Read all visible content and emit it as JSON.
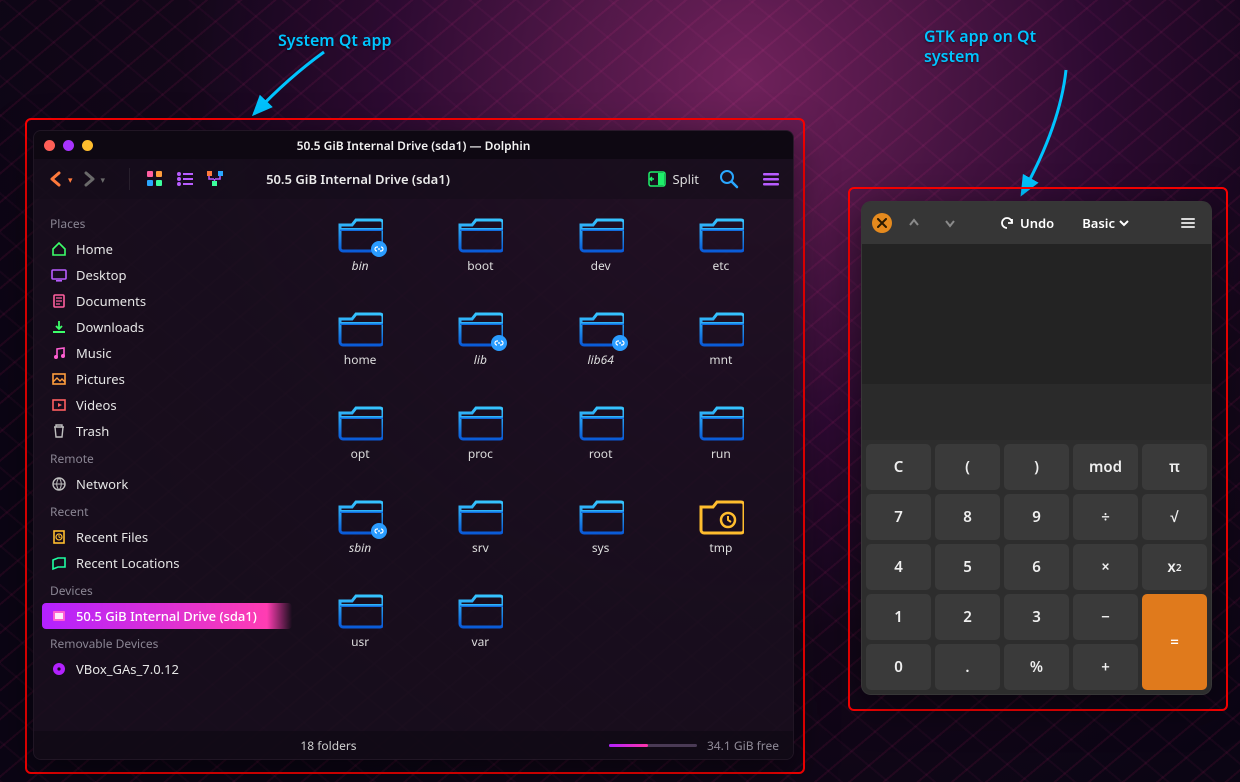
{
  "annotations": {
    "left": "System Qt app",
    "right": "GTK app on Qt\nsystem"
  },
  "dolphin": {
    "title": "50.5 GiB Internal Drive (sda1) — Dolphin",
    "breadcrumb": "50.5 GiB Internal Drive (sda1)",
    "split_label": "Split",
    "sidebar": {
      "sections": [
        {
          "header": "Places",
          "items": [
            {
              "label": "Home",
              "icon": "home"
            },
            {
              "label": "Desktop",
              "icon": "desktop"
            },
            {
              "label": "Documents",
              "icon": "documents"
            },
            {
              "label": "Downloads",
              "icon": "downloads"
            },
            {
              "label": "Music",
              "icon": "music"
            },
            {
              "label": "Pictures",
              "icon": "pictures"
            },
            {
              "label": "Videos",
              "icon": "videos"
            },
            {
              "label": "Trash",
              "icon": "trash"
            }
          ]
        },
        {
          "header": "Remote",
          "items": [
            {
              "label": "Network",
              "icon": "network"
            }
          ]
        },
        {
          "header": "Recent",
          "items": [
            {
              "label": "Recent Files",
              "icon": "recent-files"
            },
            {
              "label": "Recent Locations",
              "icon": "recent-locations"
            }
          ]
        },
        {
          "header": "Devices",
          "items": [
            {
              "label": "50.5 GiB Internal Drive (sda1)",
              "icon": "drive",
              "selected": true
            }
          ]
        },
        {
          "header": "Removable Devices",
          "items": [
            {
              "label": "VBox_GAs_7.0.12",
              "icon": "disc"
            }
          ]
        }
      ]
    },
    "folders": [
      {
        "name": "bin",
        "link": true
      },
      {
        "name": "boot",
        "link": false
      },
      {
        "name": "dev",
        "link": false
      },
      {
        "name": "etc",
        "link": false
      },
      {
        "name": "home",
        "link": false
      },
      {
        "name": "lib",
        "link": true
      },
      {
        "name": "lib64",
        "link": true
      },
      {
        "name": "mnt",
        "link": false
      },
      {
        "name": "opt",
        "link": false
      },
      {
        "name": "proc",
        "link": false
      },
      {
        "name": "root",
        "link": false
      },
      {
        "name": "run",
        "link": false
      },
      {
        "name": "sbin",
        "link": true
      },
      {
        "name": "srv",
        "link": false
      },
      {
        "name": "sys",
        "link": false
      },
      {
        "name": "tmp",
        "link": false,
        "special": "tmp"
      },
      {
        "name": "usr",
        "link": false
      },
      {
        "name": "var",
        "link": false
      }
    ],
    "status": {
      "count": "18 folders",
      "free": "34.1 GiB free",
      "used_pct": 44
    }
  },
  "calculator": {
    "undo_label": "Undo",
    "mode_label": "Basic",
    "keys": [
      [
        "C",
        "(",
        ")",
        "mod",
        "π"
      ],
      [
        "7",
        "8",
        "9",
        "÷",
        "√"
      ],
      [
        "4",
        "5",
        "6",
        "×",
        "x²"
      ],
      [
        "1",
        "2",
        "3",
        "−",
        "="
      ],
      [
        "0",
        ".",
        "%",
        "+"
      ]
    ]
  }
}
